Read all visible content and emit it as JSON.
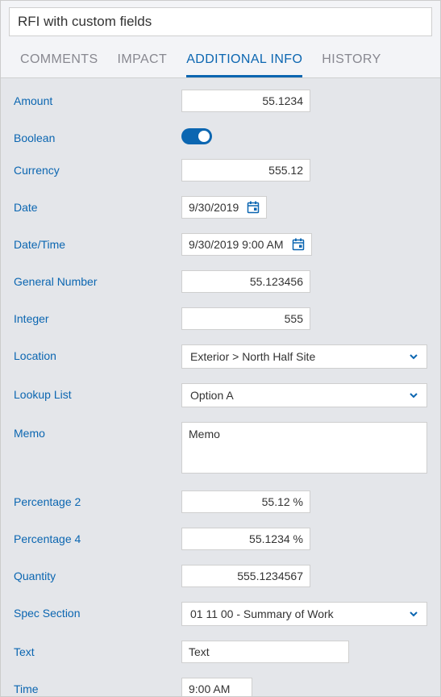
{
  "title": "RFI with custom fields",
  "tabs": {
    "comments": "COMMENTS",
    "impact": "IMPACT",
    "additional": "ADDITIONAL INFO",
    "history": "HISTORY",
    "active": "additional"
  },
  "fields": {
    "amount": {
      "label": "Amount",
      "value": "55.1234"
    },
    "boolean": {
      "label": "Boolean",
      "value": true
    },
    "currency": {
      "label": "Currency",
      "value": "555.12"
    },
    "date": {
      "label": "Date",
      "value": "9/30/2019"
    },
    "datetime": {
      "label": "Date/Time",
      "value": "9/30/2019 9:00 AM"
    },
    "general": {
      "label": "General Number",
      "value": "55.123456"
    },
    "integer": {
      "label": "Integer",
      "value": "555"
    },
    "location": {
      "label": "Location",
      "value": "Exterior > North Half Site"
    },
    "lookup": {
      "label": "Lookup List",
      "value": "Option A"
    },
    "memo": {
      "label": "Memo",
      "value": "Memo"
    },
    "percent2": {
      "label": "Percentage 2",
      "value": "55.12 %"
    },
    "percent4": {
      "label": "Percentage 4",
      "value": "55.1234 %"
    },
    "quantity": {
      "label": "Quantity",
      "value": "555.1234567"
    },
    "spec": {
      "label": "Spec Section",
      "value": "01 11 00 - Summary of Work"
    },
    "text": {
      "label": "Text",
      "value": "Text"
    },
    "time": {
      "label": "Time",
      "value": "9:00 AM"
    }
  },
  "colors": {
    "accent": "#0b66b1"
  }
}
